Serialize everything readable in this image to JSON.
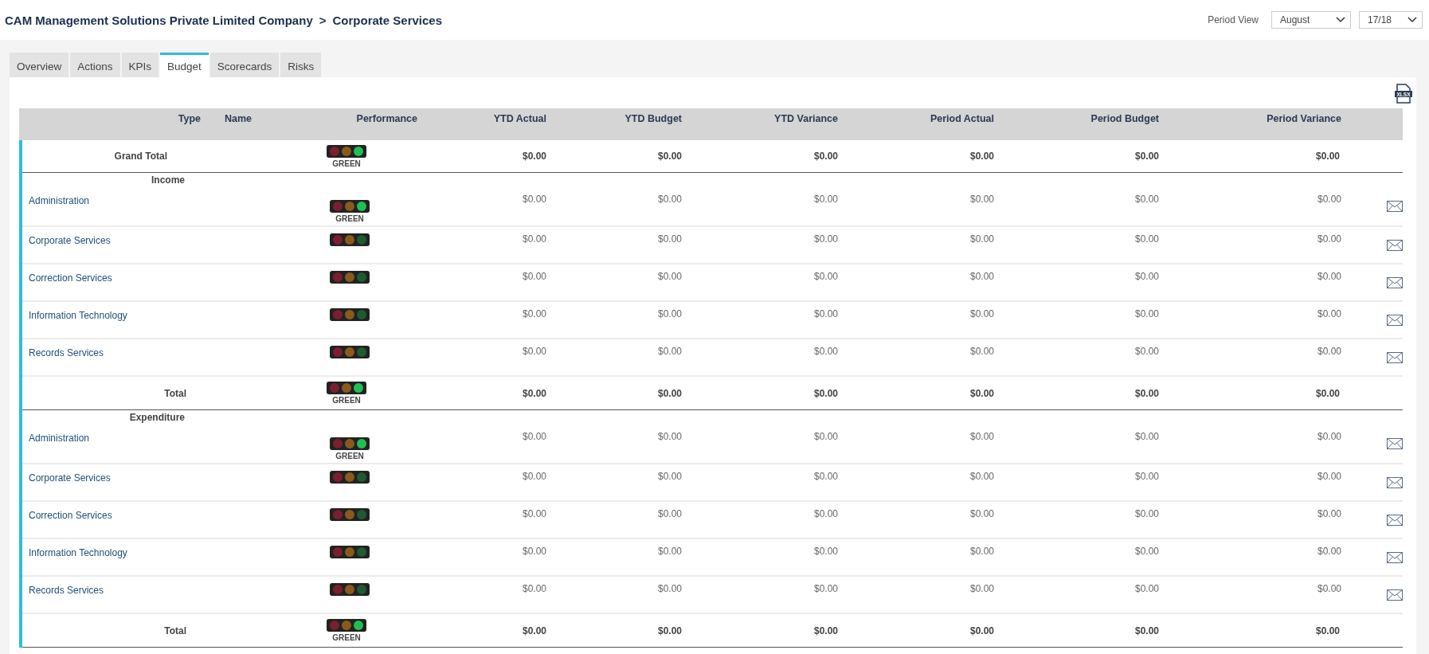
{
  "header": {
    "breadcrumb": [
      "CAM Management Solutions Private Limited Company",
      "Corporate Services"
    ],
    "separator": ">",
    "period_label": "Period View",
    "period": "August",
    "year": "17/18"
  },
  "tabs": [
    {
      "label": "Overview",
      "selected": false
    },
    {
      "label": "Actions",
      "selected": false
    },
    {
      "label": "KPIs",
      "selected": false
    },
    {
      "label": "Budget",
      "selected": true
    },
    {
      "label": "Scorecards",
      "selected": false
    },
    {
      "label": "Risks",
      "selected": false
    }
  ],
  "export_label": "XLSX",
  "table": {
    "columns": [
      "Type",
      "Name",
      "Performance",
      "YTD Actual",
      "YTD Budget",
      "YTD Variance",
      "Period Actual",
      "Period Budget",
      "Period Variance"
    ],
    "rows": [
      {
        "kind": "grand_total",
        "label": "Grand Total",
        "performance": {
          "lit": true,
          "caption": "GREEN"
        },
        "values": [
          "$0.00",
          "$0.00",
          "$0.00",
          "$0.00",
          "$0.00",
          "$0.00"
        ]
      },
      {
        "kind": "section",
        "label": "Income"
      },
      {
        "kind": "item",
        "label": "Administration",
        "performance": {
          "lit": true,
          "caption": "GREEN"
        },
        "values": [
          "$0.00",
          "$0.00",
          "$0.00",
          "$0.00",
          "$0.00",
          "$0.00"
        ]
      },
      {
        "kind": "item",
        "label": "Corporate Services",
        "performance": {
          "lit": false
        },
        "values": [
          "$0.00",
          "$0.00",
          "$0.00",
          "$0.00",
          "$0.00",
          "$0.00"
        ]
      },
      {
        "kind": "item",
        "label": "Correction Services",
        "performance": {
          "lit": false
        },
        "values": [
          "$0.00",
          "$0.00",
          "$0.00",
          "$0.00",
          "$0.00",
          "$0.00"
        ]
      },
      {
        "kind": "item",
        "label": "Information Technology",
        "performance": {
          "lit": false
        },
        "values": [
          "$0.00",
          "$0.00",
          "$0.00",
          "$0.00",
          "$0.00",
          "$0.00"
        ]
      },
      {
        "kind": "item",
        "label": "Records Services",
        "performance": {
          "lit": false
        },
        "values": [
          "$0.00",
          "$0.00",
          "$0.00",
          "$0.00",
          "$0.00",
          "$0.00"
        ]
      },
      {
        "kind": "total",
        "label": "Total",
        "performance": {
          "lit": true,
          "caption": "GREEN"
        },
        "values": [
          "$0.00",
          "$0.00",
          "$0.00",
          "$0.00",
          "$0.00",
          "$0.00"
        ]
      },
      {
        "kind": "section",
        "label": "Expenditure"
      },
      {
        "kind": "item",
        "label": "Administration",
        "performance": {
          "lit": true,
          "caption": "GREEN"
        },
        "values": [
          "$0.00",
          "$0.00",
          "$0.00",
          "$0.00",
          "$0.00",
          "$0.00"
        ]
      },
      {
        "kind": "item",
        "label": "Corporate Services",
        "performance": {
          "lit": false
        },
        "values": [
          "$0.00",
          "$0.00",
          "$0.00",
          "$0.00",
          "$0.00",
          "$0.00"
        ]
      },
      {
        "kind": "item",
        "label": "Correction Services",
        "performance": {
          "lit": false
        },
        "values": [
          "$0.00",
          "$0.00",
          "$0.00",
          "$0.00",
          "$0.00",
          "$0.00"
        ]
      },
      {
        "kind": "item",
        "label": "Information Technology",
        "performance": {
          "lit": false
        },
        "values": [
          "$0.00",
          "$0.00",
          "$0.00",
          "$0.00",
          "$0.00",
          "$0.00"
        ]
      },
      {
        "kind": "item",
        "label": "Records Services",
        "performance": {
          "lit": false
        },
        "values": [
          "$0.00",
          "$0.00",
          "$0.00",
          "$0.00",
          "$0.00",
          "$0.00"
        ]
      },
      {
        "kind": "total",
        "label": "Total",
        "performance": {
          "lit": true,
          "caption": "GREEN"
        },
        "values": [
          "$0.00",
          "$0.00",
          "$0.00",
          "$0.00",
          "$0.00",
          "$0.00"
        ]
      }
    ]
  }
}
